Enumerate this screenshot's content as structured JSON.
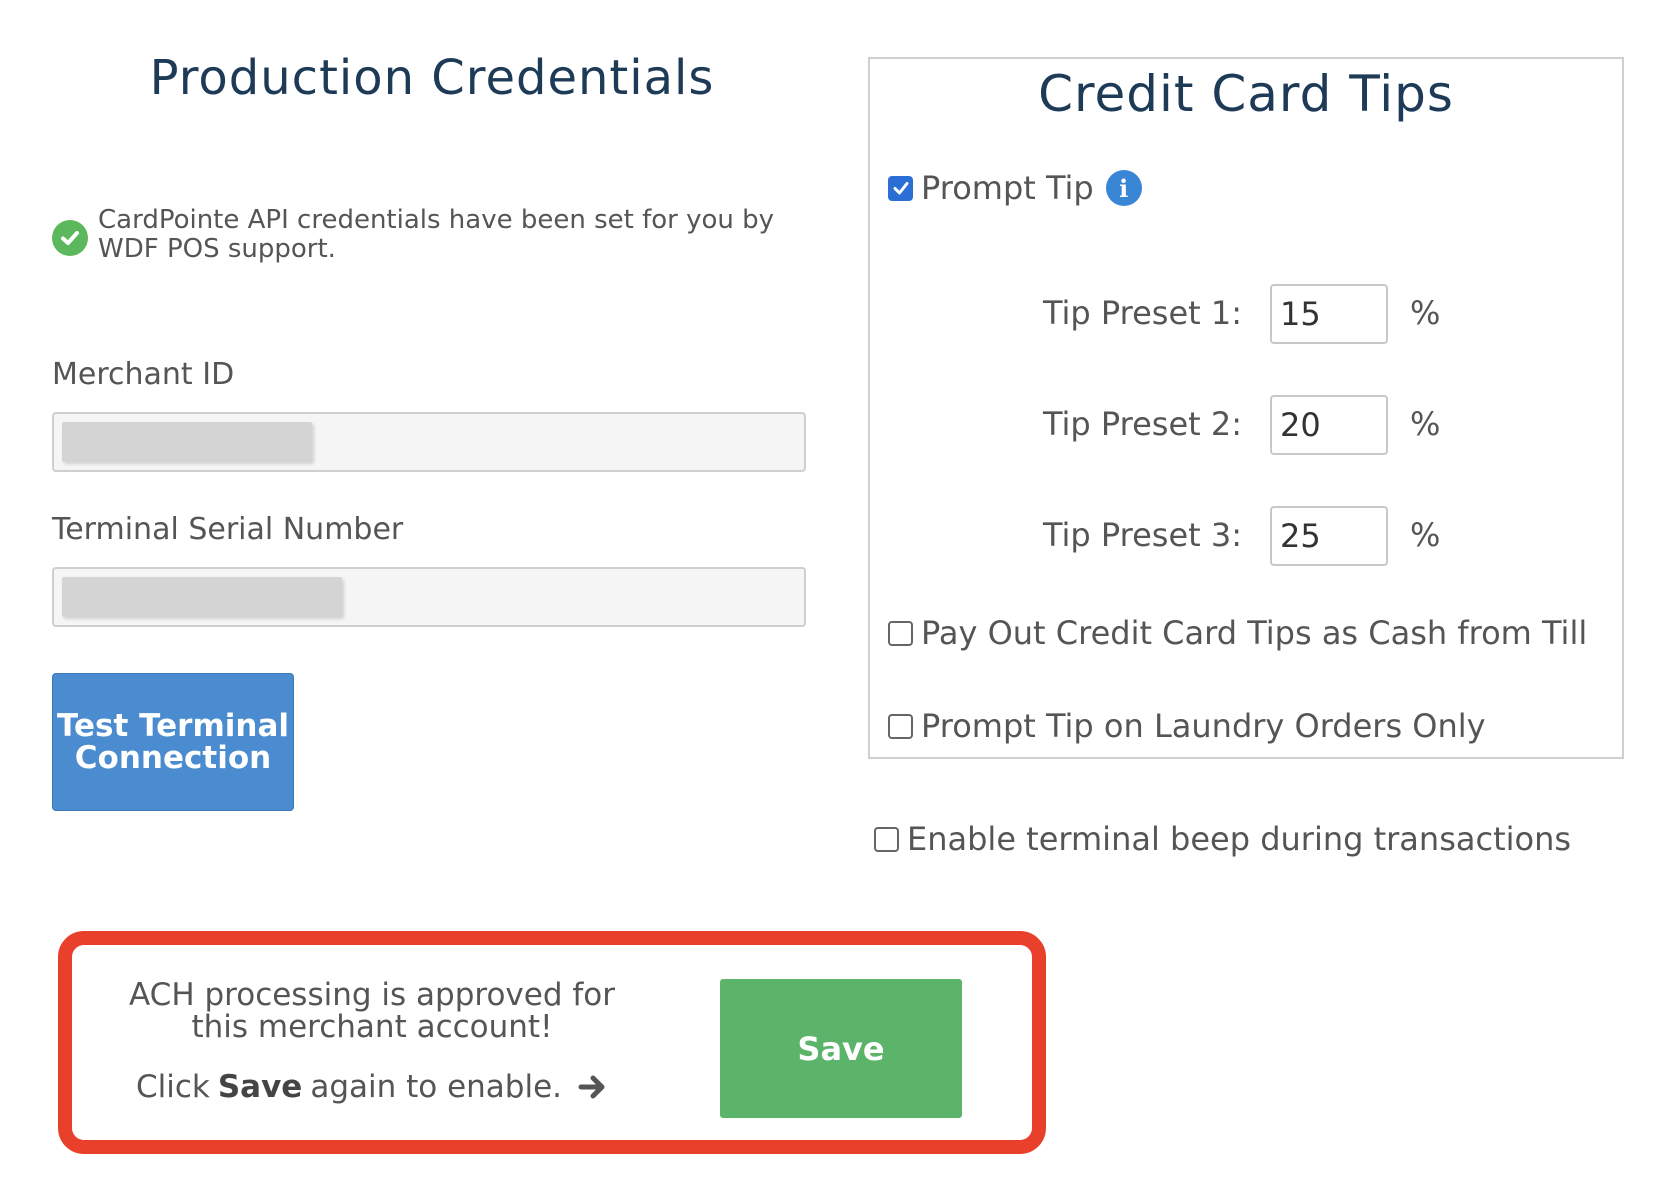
{
  "left": {
    "title": "Production Credentials",
    "notice": "CardPointe API credentials have been set for you by WDF POS support.",
    "merchant_label": "Merchant ID",
    "serial_label": "Terminal Serial Number",
    "test_button": "Test Terminal Connection"
  },
  "tips": {
    "title": "Credit Card Tips",
    "prompt_tip_label": "Prompt Tip",
    "prompt_tip_checked": true,
    "presets": [
      {
        "label": "Tip Preset 1:",
        "value": "15",
        "unit": "%"
      },
      {
        "label": "Tip Preset 2:",
        "value": "20",
        "unit": "%"
      },
      {
        "label": "Tip Preset 3:",
        "value": "25",
        "unit": "%"
      }
    ],
    "payout_label": "Pay Out Credit Card Tips as Cash from Till",
    "laundry_label": "Prompt Tip on Laundry Orders Only"
  },
  "beep_label": "Enable terminal beep during transactions",
  "ach": {
    "message": "ACH processing is approved for this merchant account!",
    "sub_prefix": "Click",
    "sub_bold": "Save",
    "sub_suffix": "again to enable.",
    "save_button": "Save"
  },
  "colors": {
    "title": "#1d3a57",
    "primary_button": "#4a8ccf",
    "save_button": "#5cb36a",
    "highlight_border": "#e8402a",
    "success_icon": "#5cb85c",
    "info_icon": "#3a86d6"
  },
  "icons": [
    "check-circle-icon",
    "info-icon",
    "arrow-right-icon"
  ]
}
